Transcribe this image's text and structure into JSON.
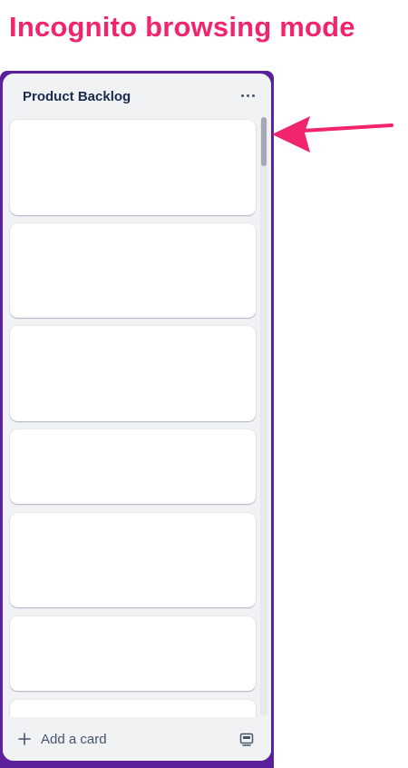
{
  "annotation": {
    "title": "Incognito browsing mode",
    "arrow_color": "#f0256e"
  },
  "list": {
    "title": "Product Backlog",
    "menu_icon": "ellipsis-icon",
    "card_count_visible": 7,
    "add_card_label": "Add a card",
    "add_icon": "plus-icon",
    "template_icon": "card-template-icon"
  },
  "colors": {
    "board_background": "#5b219c",
    "list_background": "#f1f2f4",
    "card_background": "#ffffff",
    "text": "#172b4d"
  }
}
